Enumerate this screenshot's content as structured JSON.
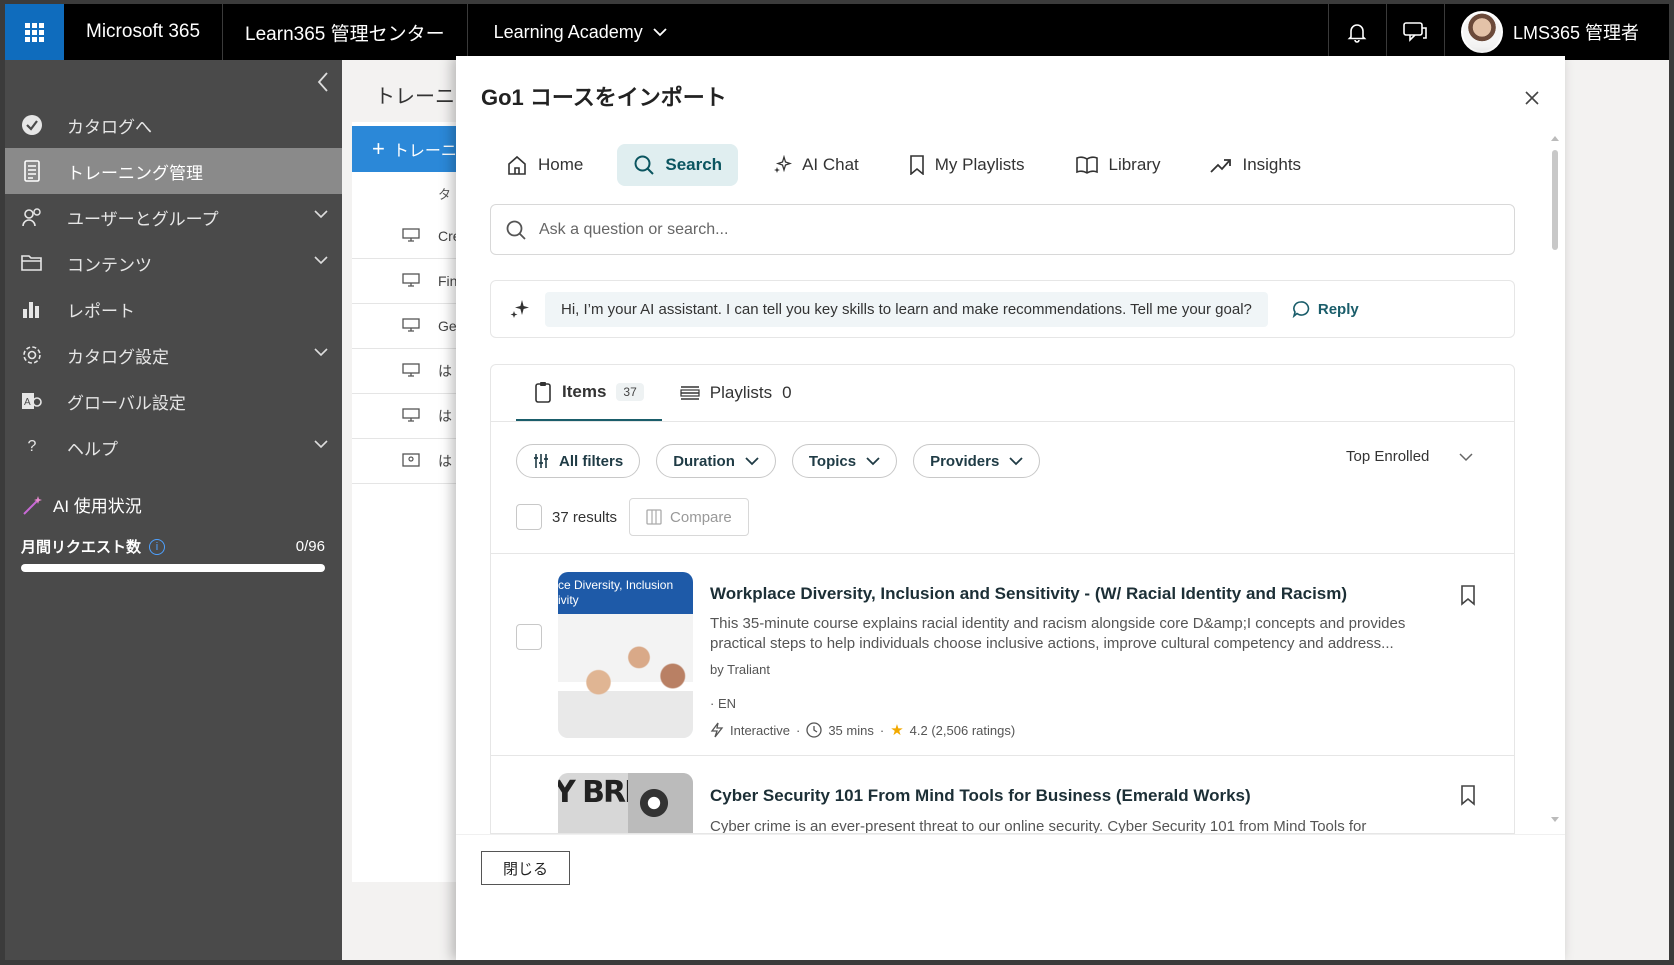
{
  "topbar": {
    "brand": "Microsoft 365",
    "app": "Learn365 管理センター",
    "org": "Learning Academy",
    "user": "LMS365 管理者"
  },
  "sidebar": {
    "items": [
      {
        "label": "カタログへ",
        "icon": "catalog-check-icon",
        "chevron": false
      },
      {
        "label": "トレーニング管理",
        "icon": "training-doc-icon",
        "chevron": false,
        "active": true
      },
      {
        "label": "ユーザーとグループ",
        "icon": "users-icon",
        "chevron": true
      },
      {
        "label": "コンテンツ",
        "icon": "folder-icon",
        "chevron": true
      },
      {
        "label": "レポート",
        "icon": "bar-chart-icon",
        "chevron": false
      },
      {
        "label": "カタログ設定",
        "icon": "gear-icon",
        "chevron": true
      },
      {
        "label": "グローバル設定",
        "icon": "global-settings-icon",
        "chevron": false
      },
      {
        "label": "ヘルプ",
        "icon": "help-icon",
        "chevron": true
      }
    ],
    "ai_usage_title": "AI 使用状況",
    "monthly_requests_label": "月間リクエスト数",
    "monthly_requests_value": "0/96",
    "monthly_requests_fraction": 0
  },
  "background_page": {
    "title": "トレーニ",
    "new_button": "トレーニ",
    "column_header": "タ",
    "rows": [
      "Cre",
      "Fin",
      "Ge",
      "は",
      "は",
      "は"
    ]
  },
  "panel": {
    "title": "Go1 コースをインポート",
    "tabs": [
      {
        "label": "Home",
        "icon": "home-icon"
      },
      {
        "label": "Search",
        "icon": "search-icon",
        "active": true
      },
      {
        "label": "AI Chat",
        "icon": "sparkle-icon"
      },
      {
        "label": "My Playlists",
        "icon": "bookmark-icon"
      },
      {
        "label": "Library",
        "icon": "book-icon"
      },
      {
        "label": "Insights",
        "icon": "trend-icon"
      }
    ],
    "search_placeholder": "Ask a question or search...",
    "ai_message": "Hi, I’m your AI assistant. I can tell you key skills to learn and make recommendations. Tell me your goal?",
    "reply_label": "Reply",
    "result_tabs": {
      "items_label": "Items",
      "items_count": "37",
      "playlists_label": "Playlists",
      "playlists_count": "0"
    },
    "filters": [
      "All filters",
      "Duration",
      "Topics",
      "Providers"
    ],
    "sort_label": "Top Enrolled",
    "results_count": "37 results",
    "compare_label": "Compare",
    "courses": [
      {
        "thumb_text_line1": "ce Diversity, Inclusion",
        "thumb_text_line2": "ivity",
        "title": "Workplace Diversity, Inclusion and Sensitivity - (W/ Racial Identity and Racism)",
        "description": "This 35-minute course explains racial identity and racism alongside core D&amp;I concepts and provides practical steps to help individuals choose inclusive actions, improve cultural competency and address...",
        "provider": "by Traliant",
        "language": "EN",
        "type": "Interactive",
        "duration": "35 mins",
        "rating": "4.2 (2,506 ratings)"
      },
      {
        "thumb_text": "Y BRE",
        "title": "Cyber Security 101 From Mind Tools for Business (Emerald Works)",
        "description": "Cyber crime is an ever-present threat to our online security. Cyber Security 101 from Mind Tools for"
      }
    ],
    "close_button": "閉じる"
  }
}
